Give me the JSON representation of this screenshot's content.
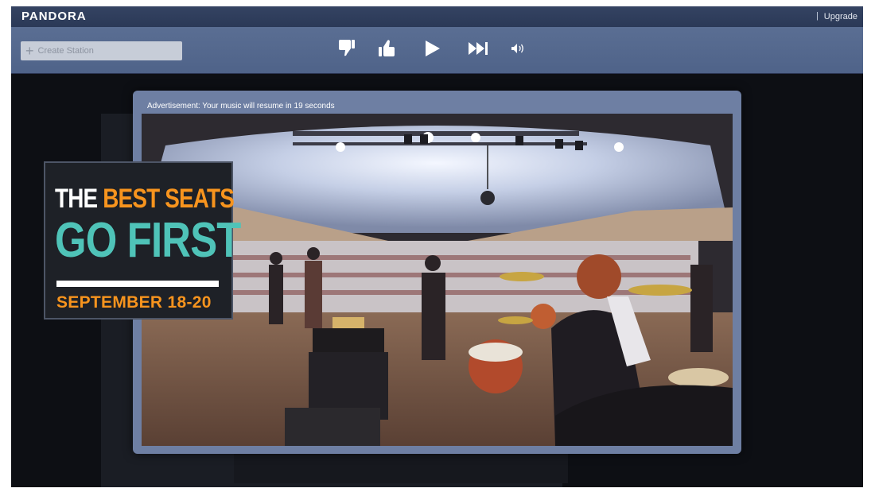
{
  "header": {
    "logo": "PANDORA",
    "separator": "|",
    "upgrade_label": "Upgrade"
  },
  "toolbar": {
    "create_station_placeholder": "Create Station",
    "controls": [
      "thumbs-down-icon",
      "thumbs-up-icon",
      "play-icon",
      "skip-icon",
      "volume-icon"
    ]
  },
  "ad_modal": {
    "message": "Advertisement: Your music will resume in 19 seconds"
  },
  "ad_badge": {
    "line1_white": "THE",
    "line1_orange": "BEST SEATS",
    "line2": "GO FIRST",
    "date": "SEPTEMBER 18-20"
  },
  "colors": {
    "accent_orange": "#f7941e",
    "accent_teal": "#4fc3b8",
    "toolbar_blue": "#56698f"
  }
}
